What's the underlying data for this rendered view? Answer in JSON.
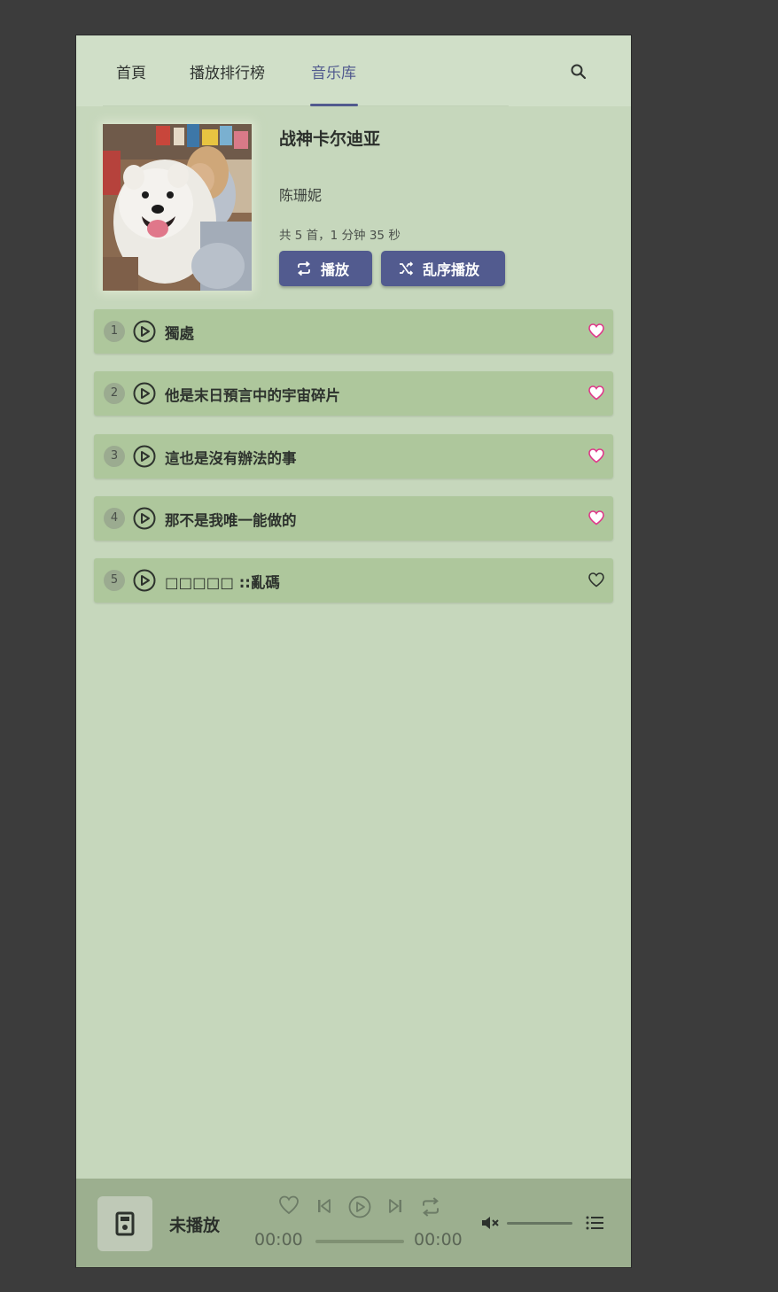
{
  "nav": {
    "tabs": [
      {
        "label": "首頁"
      },
      {
        "label": "播放排行榜"
      },
      {
        "label": "音乐库"
      }
    ],
    "active_tab": "音乐库",
    "search_icon": "search-icon"
  },
  "album": {
    "title": "战神卡尔迪亚",
    "artist": "陈珊妮",
    "meta": "共 5 首，1 分钟 35 秒",
    "play_label": "播放",
    "shuffle_label": "乱序播放"
  },
  "songs": [
    {
      "num": "1",
      "title": "獨處",
      "liked": true
    },
    {
      "num": "2",
      "title": "他是末日預言中的宇宙碎片",
      "liked": true
    },
    {
      "num": "3",
      "title": "這也是沒有辦法的事",
      "liked": true
    },
    {
      "num": "4",
      "title": "那不是我唯一能做的",
      "liked": true
    },
    {
      "num": "5",
      "title": "□□□□□ ::亂碼",
      "liked": false
    }
  ],
  "player": {
    "title": "未播放",
    "current_time": "00:00",
    "total_time": "00:00",
    "progress": 0,
    "muted": true
  },
  "colors": {
    "accent": "#525b8f",
    "background": "#c6d7bc",
    "song_row": "#aec79c",
    "like_pink": "#e0378a"
  }
}
